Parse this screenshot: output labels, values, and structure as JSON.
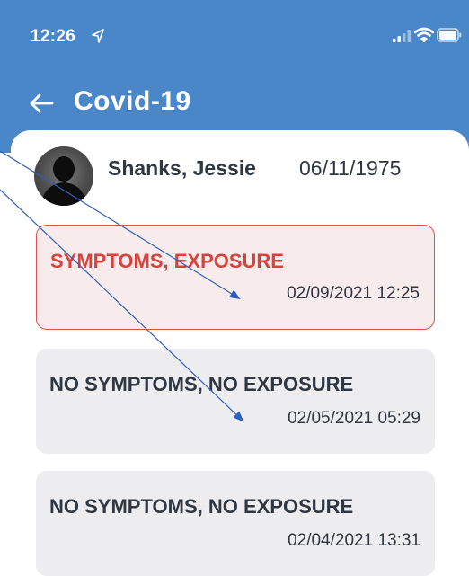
{
  "status_bar": {
    "time": "12:26"
  },
  "header": {
    "title": "Covid-19"
  },
  "patient": {
    "name": "Shanks, Jessie",
    "dob": "06/11/1975"
  },
  "screenings": [
    {
      "status": "SYMPTOMS, EXPOSURE",
      "datetime": "02/09/2021 12:25",
      "flagged": true
    },
    {
      "status": "NO SYMPTOMS, NO EXPOSURE",
      "datetime": "02/05/2021 05:29",
      "flagged": false
    },
    {
      "status": "NO SYMPTOMS, NO EXPOSURE",
      "datetime": "02/04/2021 13:31",
      "flagged": false
    }
  ],
  "colors": {
    "header_bg": "#4a87c9",
    "alert_red": "#d9413c",
    "card_bg": "#ededf0",
    "alert_card_bg": "#f8ebeb",
    "text_dark": "#2f3742",
    "annotation_blue": "#2f5fbf"
  }
}
